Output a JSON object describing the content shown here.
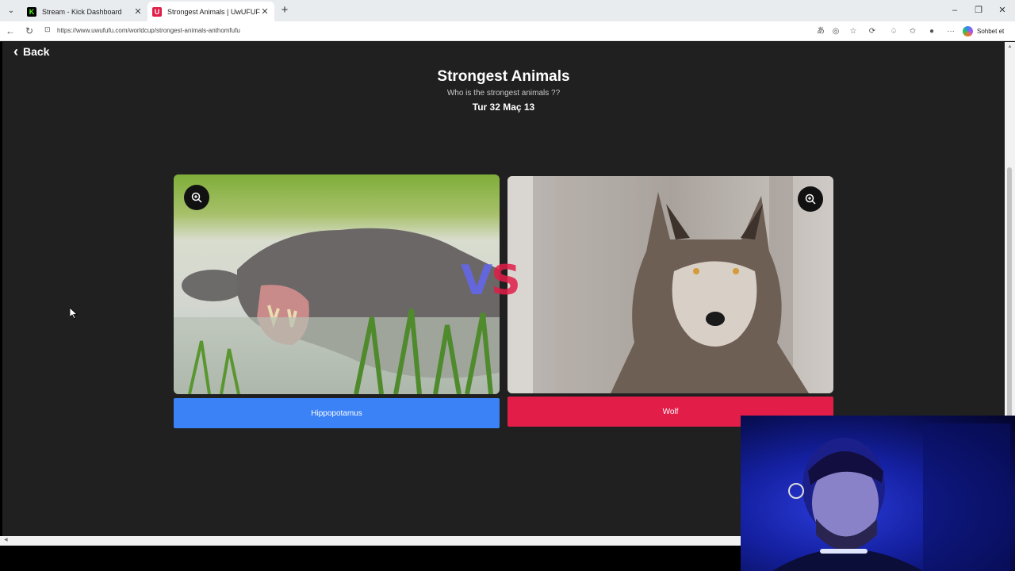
{
  "browser": {
    "tabs": [
      {
        "title": "Stream - Kick Dashboard",
        "favicon": "K",
        "favicon_color": "#53fc18",
        "active": false
      },
      {
        "title": "Strongest Animals | UwUFUFU",
        "favicon": "U",
        "favicon_color": "#e11d48",
        "active": true
      }
    ],
    "url": "https://www.uwufufu.com/worldcup/strongest-animals-anthomfufu",
    "copilot_label": "Sohbet et"
  },
  "page": {
    "back_label": "Back",
    "title": "Strongest Animals",
    "subtitle": "Who is the strongest animals ??",
    "round": "Tur 32 Maç 13",
    "vs_v": "V",
    "vs_s": "S",
    "left_choice": {
      "label": "Hippopotamus",
      "color": "#3b82f6",
      "icon": "zoom-in-icon"
    },
    "right_choice": {
      "label": "Wolf",
      "color": "#e11d48",
      "icon": "zoom-in-icon"
    }
  }
}
